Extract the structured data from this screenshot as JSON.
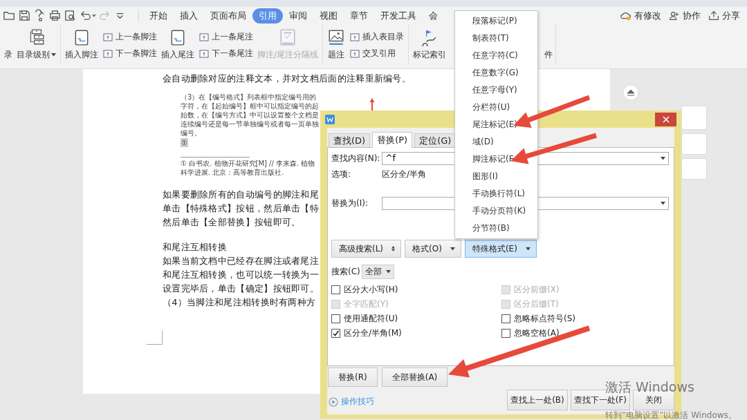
{
  "ribbon_tabs": [
    {
      "label": "开始",
      "selected": false
    },
    {
      "label": "插入",
      "selected": false
    },
    {
      "label": "页面布局",
      "selected": false
    },
    {
      "label": "引用",
      "selected": true
    },
    {
      "label": "审阅",
      "selected": false
    },
    {
      "label": "视图",
      "selected": false
    },
    {
      "label": "章节",
      "selected": false
    },
    {
      "label": "开发工具",
      "selected": false
    },
    {
      "label": "会",
      "selected": false
    }
  ],
  "header_actions": [
    {
      "kind": "status",
      "label": "有修改"
    },
    {
      "kind": "collab",
      "label": "协作"
    },
    {
      "kind": "share",
      "label": "分享"
    }
  ],
  "ribbon_groups": [
    {
      "items": [
        {
          "kind": "large",
          "label": "录",
          "dropdown": false,
          "disabled": false
        },
        {
          "kind": "large",
          "label": "目录级别",
          "dropdown": true,
          "disabled": false
        }
      ]
    },
    {
      "items": [
        {
          "kind": "large",
          "label": "插入脚注",
          "dropdown": false,
          "disabled": false
        },
        {
          "kind": "stack",
          "items": [
            {
              "label": "上一条脚注"
            },
            {
              "label": "下一条脚注"
            }
          ]
        },
        {
          "kind": "large",
          "label": "插入尾注",
          "dropdown": false,
          "disabled": false
        },
        {
          "kind": "stack",
          "items": [
            {
              "label": "上一条尾注"
            },
            {
              "label": "下一条尾注"
            }
          ]
        },
        {
          "kind": "large",
          "label": "脚注/尾注分隔线",
          "dropdown": false,
          "disabled": true
        }
      ]
    },
    {
      "items": [
        {
          "kind": "large",
          "label": "题注",
          "dropdown": false,
          "disabled": false
        },
        {
          "kind": "stack",
          "items": [
            {
              "label": "插入表目录"
            },
            {
              "label": "交叉引用"
            }
          ]
        }
      ]
    },
    {
      "items": [
        {
          "kind": "large",
          "label": "标记索引",
          "dropdown": false,
          "disabled": false
        },
        {
          "kind": "tail",
          "label": "件"
        }
      ]
    }
  ],
  "document": {
    "lead": "会自动删除对应的注释文本，并对文档后面的注释重新编号。",
    "figure": {
      "text": "（3）在【编号格式】列表框中指定编号用的字符，在【起始编号】框中可以指定编号的起始数，在【编号方式】中可以设置整个文档是连续编号还是每一节单独编号或者每一页单独编号。",
      "note_ref": "①",
      "footnote": "① 白书农. 植物开花研究[M] // 李来森. 植物科学进展. 北京：高等教育出版社."
    },
    "paragraphs": [
      {
        "lines": [
          "如果要删除所有的自动编号的脚注和尾",
          "单击【特殊格式】按钮，然后单击【特",
          "然后单击【全部替换】按钮即可。"
        ]
      },
      {
        "lines": [
          "和尾注互相转换",
          "如果当前文档中已经存在脚注或者尾注",
          "和尾注互相转换，也可以统一转换为一",
          "设置完毕后，单击【确定】按钮即可。",
          "（4）当脚注和尾注相转换时有两种方"
        ]
      }
    ]
  },
  "dialog": {
    "tabs": [
      {
        "label": "查找(D)",
        "selected": false
      },
      {
        "label": "替换(P)",
        "selected": true
      },
      {
        "label": "定位(G)",
        "selected": false
      }
    ],
    "find_label": "查找内容(N):",
    "find_value": "^f",
    "options_label": "选项:",
    "options_value": "区分全/半角",
    "replace_label": "替换为(I):",
    "format_buttons": [
      {
        "label": "高级搜索(L)",
        "kind": "toggle",
        "pressed": false
      },
      {
        "label": "格式(O)",
        "kind": "dropdown",
        "pressed": false
      },
      {
        "label": "特殊格式(E)",
        "kind": "dropdown",
        "pressed": true
      }
    ],
    "search_label": "搜索(C)",
    "search_scope": "全部",
    "options": [
      {
        "label": "区分大小写(H)",
        "checked": false,
        "disabled": false
      },
      {
        "label": "区分前缀(X)",
        "checked": false,
        "disabled": true
      },
      {
        "label": "全字匹配(Y)",
        "checked": false,
        "disabled": true
      },
      {
        "label": "区分后缀(T)",
        "checked": false,
        "disabled": true
      },
      {
        "label": "使用通配符(U)",
        "checked": false,
        "disabled": false
      },
      {
        "label": "忽略标点符号(S)",
        "checked": false,
        "disabled": false
      },
      {
        "label": "区分全/半角(M)",
        "checked": true,
        "disabled": false
      },
      {
        "label": "忽略空格(A)",
        "checked": false,
        "disabled": false
      }
    ],
    "replace_buttons": [
      "替换(R)",
      "全部替换(A)"
    ],
    "tips_link": "操作技巧",
    "nav_buttons": [
      "查找上一处(B)",
      "查找下一处(F)",
      "关闭"
    ]
  },
  "special_menu": {
    "items": [
      "段落标记(P)",
      "制表符(T)",
      "任意字符(C)",
      "任意数字(G)",
      "任意字母(Y)",
      "分栏符(U)",
      "尾注标记(E)",
      "域(D)",
      "脚注标记(F",
      "图形(I)",
      "手动换行符(L)",
      "手动分页符(K)",
      "分节符(B)"
    ]
  },
  "activation_notice": {
    "title": "激活 Windows",
    "hint": "转到“电脑设置”以激活 Windows。"
  }
}
